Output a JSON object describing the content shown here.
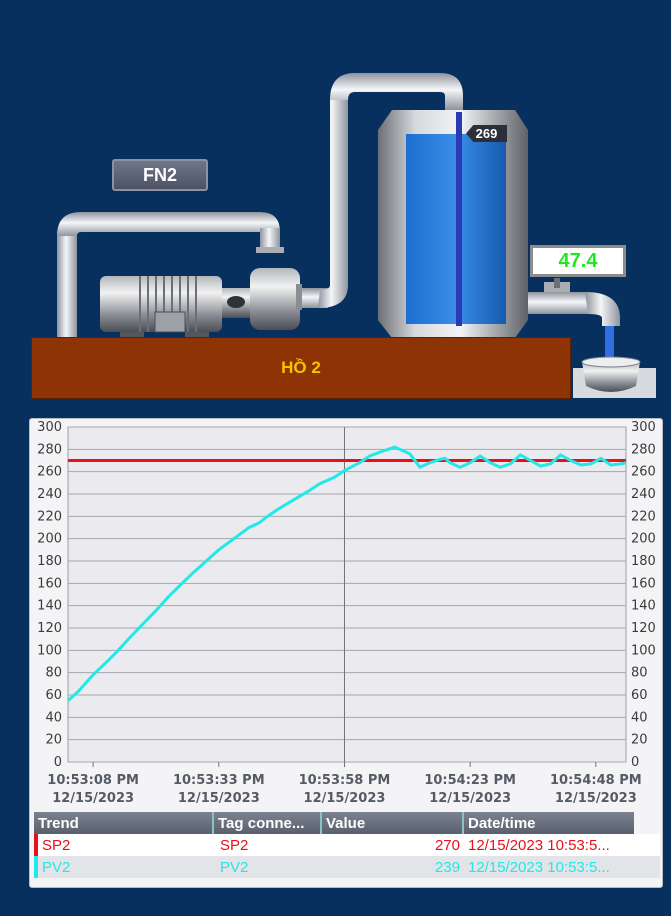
{
  "buttons": {
    "fn_label": "FN2"
  },
  "tank": {
    "level_badge": "269",
    "level_fraction": 0.9
  },
  "outlet": {
    "flow_value": "47.4"
  },
  "pond": {
    "label": "HỒ 2"
  },
  "colors": {
    "background": "#07305e",
    "setpoint": "#e8101a",
    "process": "#22e8e8",
    "flow_text": "#1ee81e",
    "pond": "#8e3303",
    "pond_text": "#f6c200"
  },
  "chart_data": {
    "type": "line",
    "x_ticks": [
      {
        "time": "10:53:08 PM",
        "date": "12/15/2023"
      },
      {
        "time": "10:53:33 PM",
        "date": "12/15/2023"
      },
      {
        "time": "10:53:58 PM",
        "date": "12/15/2023"
      },
      {
        "time": "10:54:23 PM",
        "date": "12/15/2023"
      },
      {
        "time": "10:54:48 PM",
        "date": "12/15/2023"
      }
    ],
    "x_tick_seconds": [
      5,
      30,
      55,
      80,
      105
    ],
    "x_range_seconds": [
      0,
      111
    ],
    "ylim": [
      0,
      300
    ],
    "y_ticks": [
      0,
      20,
      40,
      60,
      80,
      100,
      120,
      140,
      160,
      180,
      200,
      220,
      240,
      260,
      280,
      300
    ],
    "grid": true,
    "series": [
      {
        "name": "SP2",
        "color": "#e8101a",
        "t": [
          0,
          111
        ],
        "values": [
          270,
          270
        ]
      },
      {
        "name": "PV2",
        "color": "#22e8e8",
        "t": [
          0,
          2,
          5,
          8,
          10,
          12,
          15,
          18,
          20,
          22,
          25,
          28,
          30,
          33,
          36,
          38,
          40,
          42,
          45,
          48,
          50,
          53,
          55,
          58,
          60,
          63,
          65,
          68,
          70,
          72,
          74,
          75,
          76,
          78,
          80,
          82,
          84,
          86,
          88,
          90,
          92,
          94,
          96,
          98,
          100,
          102,
          104,
          106,
          108,
          110,
          111
        ],
        "values": [
          55,
          63,
          78,
          91,
          100,
          110,
          124,
          138,
          148,
          157,
          170,
          182,
          190,
          200,
          210,
          214,
          221,
          227,
          235,
          243,
          249,
          255,
          261,
          268,
          274,
          279,
          282,
          276,
          264,
          268,
          271,
          272,
          268,
          264,
          268,
          274,
          268,
          264,
          267,
          275,
          270,
          265,
          267,
          275,
          270,
          266,
          267,
          272,
          266,
          267,
          268
        ]
      }
    ]
  },
  "legend": {
    "headers": {
      "trend": "Trend",
      "tag": "Tag conne...",
      "value": "Value",
      "datetime": "Date/time"
    },
    "rows": [
      {
        "trend": "SP2",
        "tag": "SP2",
        "value": "270",
        "datetime": "12/15/2023 10:53:5...",
        "color": "#e8101a"
      },
      {
        "trend": "PV2",
        "tag": "PV2",
        "value": "239",
        "datetime": "12/15/2023 10:53:5...",
        "color": "#22e8e8"
      }
    ]
  }
}
